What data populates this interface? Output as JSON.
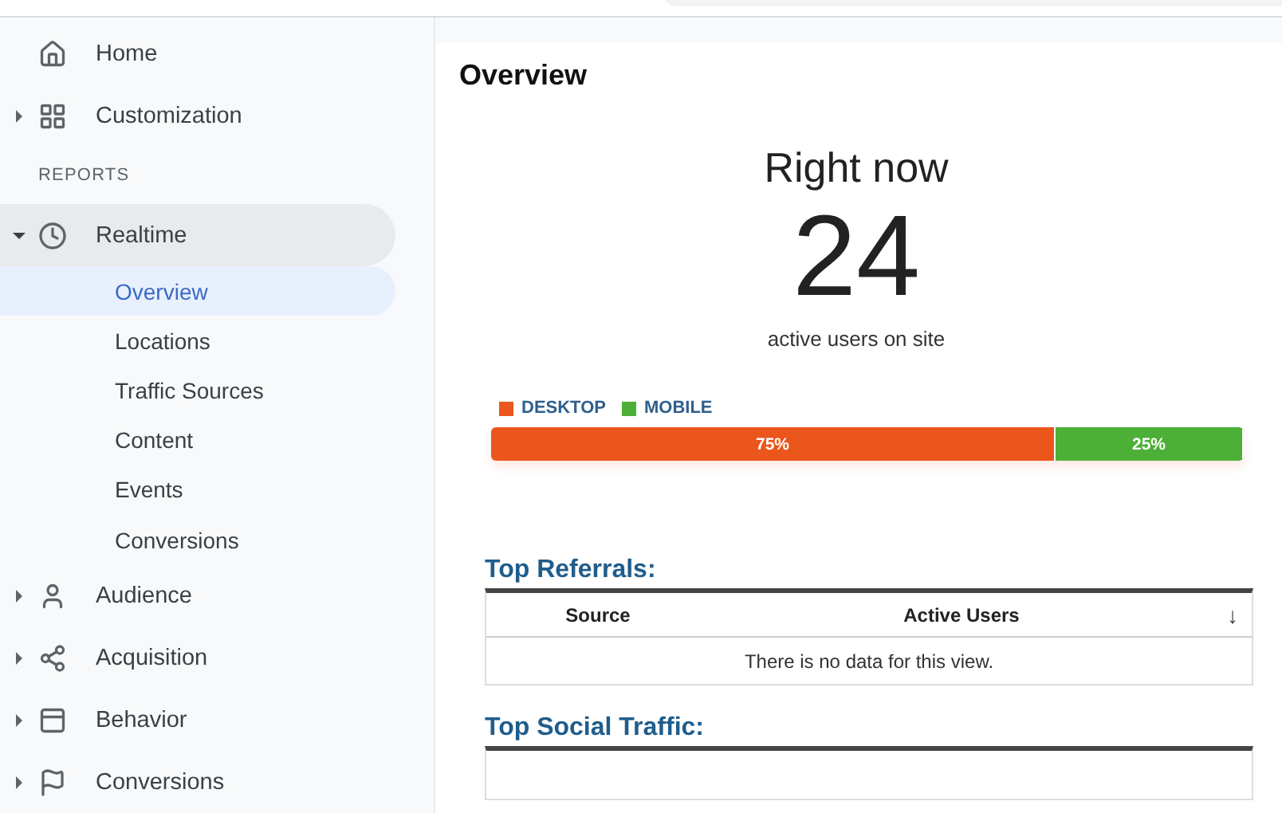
{
  "sidebar": {
    "items": [
      {
        "kind": "link",
        "label": "Home",
        "selected": false
      },
      {
        "kind": "group",
        "label": "Customization",
        "expanded": false,
        "selected": false
      },
      {
        "kind": "section",
        "label": "REPORTS"
      },
      {
        "kind": "group",
        "label": "Realtime",
        "expanded": true,
        "selected": true,
        "children": [
          {
            "label": "Overview",
            "selected": true
          },
          {
            "label": "Locations",
            "selected": false
          },
          {
            "label": "Traffic Sources",
            "selected": false
          },
          {
            "label": "Content",
            "selected": false
          },
          {
            "label": "Events",
            "selected": false
          },
          {
            "label": "Conversions",
            "selected": false
          }
        ]
      },
      {
        "kind": "group",
        "label": "Audience",
        "expanded": false,
        "selected": false
      },
      {
        "kind": "group",
        "label": "Acquisition",
        "expanded": false,
        "selected": false
      },
      {
        "kind": "group",
        "label": "Behavior",
        "expanded": false,
        "selected": false
      },
      {
        "kind": "group",
        "label": "Conversions",
        "expanded": false,
        "selected": false
      }
    ]
  },
  "page": {
    "title": "Overview",
    "realtime": {
      "heading": "Right now",
      "count": "24",
      "caption": "active users on site"
    },
    "devices": [
      {
        "label": "DESKTOP",
        "color": "#ea561b",
        "level": 0.75,
        "reading": "75%"
      },
      {
        "label": "MOBILE",
        "color": "#4caf36",
        "level": 0.25,
        "reading": "25%"
      }
    ],
    "tables": [
      {
        "title": "Top Referrals:",
        "columns": [
          "Source",
          "Active Users"
        ],
        "sort_icon": "↓",
        "empty_message": "There is no data for this view."
      },
      {
        "title": "Top Social Traffic:"
      }
    ]
  }
}
